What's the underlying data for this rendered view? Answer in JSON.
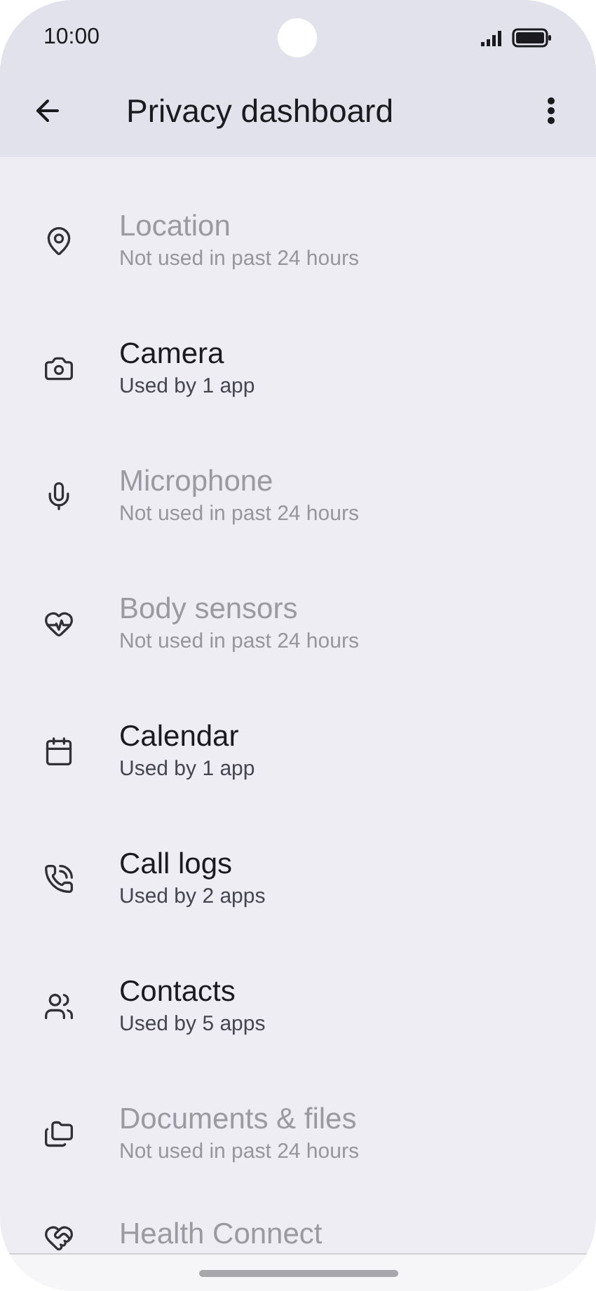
{
  "status_bar": {
    "time": "10:00"
  },
  "app_bar": {
    "title": "Privacy dashboard"
  },
  "items": [
    {
      "kind": "location",
      "title": "Location",
      "subtitle": "Not used in past 24 hours",
      "used": false
    },
    {
      "kind": "camera",
      "title": "Camera",
      "subtitle": "Used by 1 app",
      "used": true
    },
    {
      "kind": "microphone",
      "title": "Microphone",
      "subtitle": "Not used in past 24 hours",
      "used": false
    },
    {
      "kind": "body",
      "title": "Body sensors",
      "subtitle": "Not used in past 24 hours",
      "used": false
    },
    {
      "kind": "calendar",
      "title": "Calendar",
      "subtitle": "Used by 1 app",
      "used": true
    },
    {
      "kind": "calls",
      "title": "Call logs",
      "subtitle": "Used by 2 apps",
      "used": true
    },
    {
      "kind": "contacts",
      "title": "Contacts",
      "subtitle": "Used by 5 apps",
      "used": true
    },
    {
      "kind": "files",
      "title": "Documents & files",
      "subtitle": "Not used in past 24 hours",
      "used": false
    },
    {
      "kind": "health",
      "title": "Health Connect",
      "used": false
    }
  ]
}
